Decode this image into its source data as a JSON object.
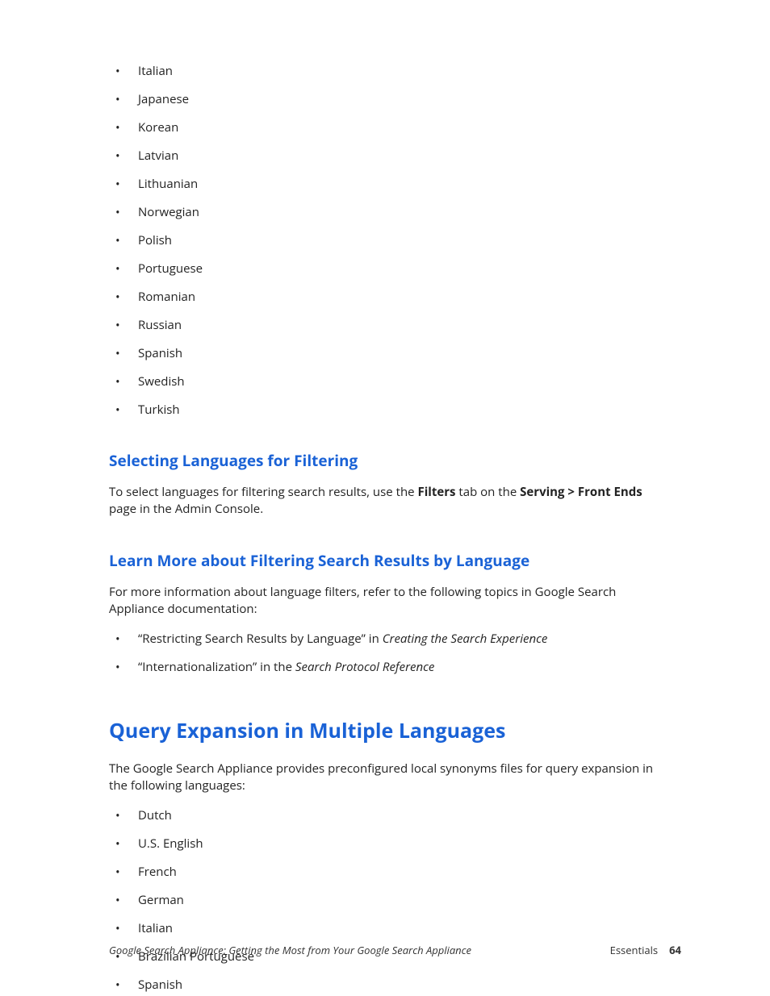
{
  "filter_languages": [
    "Italian",
    "Japanese",
    "Korean",
    "Latvian",
    "Lithuanian",
    "Norwegian",
    "Polish",
    "Portuguese",
    "Romanian",
    "Russian",
    "Spanish",
    "Swedish",
    "Turkish"
  ],
  "section1": {
    "heading": "Selecting Languages for Filtering",
    "para_pre": "To select languages for filtering search results, use the ",
    "bold1": "Filters",
    "para_mid": " tab on the ",
    "bold2": "Serving > Front Ends",
    "para_post": " page in the Admin Console."
  },
  "section2": {
    "heading": "Learn More about Filtering Search Results by Language",
    "para": "For more information about language filters, refer to the following topics in Google Search Appliance documentation:",
    "items": [
      {
        "pre": "“Restricting Search Results by Language” in ",
        "ital": "Creating the Search Experience"
      },
      {
        "pre": "“Internationalization” in the ",
        "ital": "Search Protocol Reference"
      }
    ]
  },
  "section3": {
    "heading": "Query Expansion in Multiple Languages",
    "para": "The Google Search Appliance provides preconfigured local synonyms files for query expansion in the following languages:",
    "languages": [
      "Dutch",
      "U.S. English",
      "French",
      "German",
      "Italian",
      "Brazilian Portuguese",
      "Spanish"
    ]
  },
  "footer": {
    "left": "Google Search Appliance: Getting the Most from Your Google Search Appliance",
    "right_label": "Essentials",
    "page": "64"
  }
}
